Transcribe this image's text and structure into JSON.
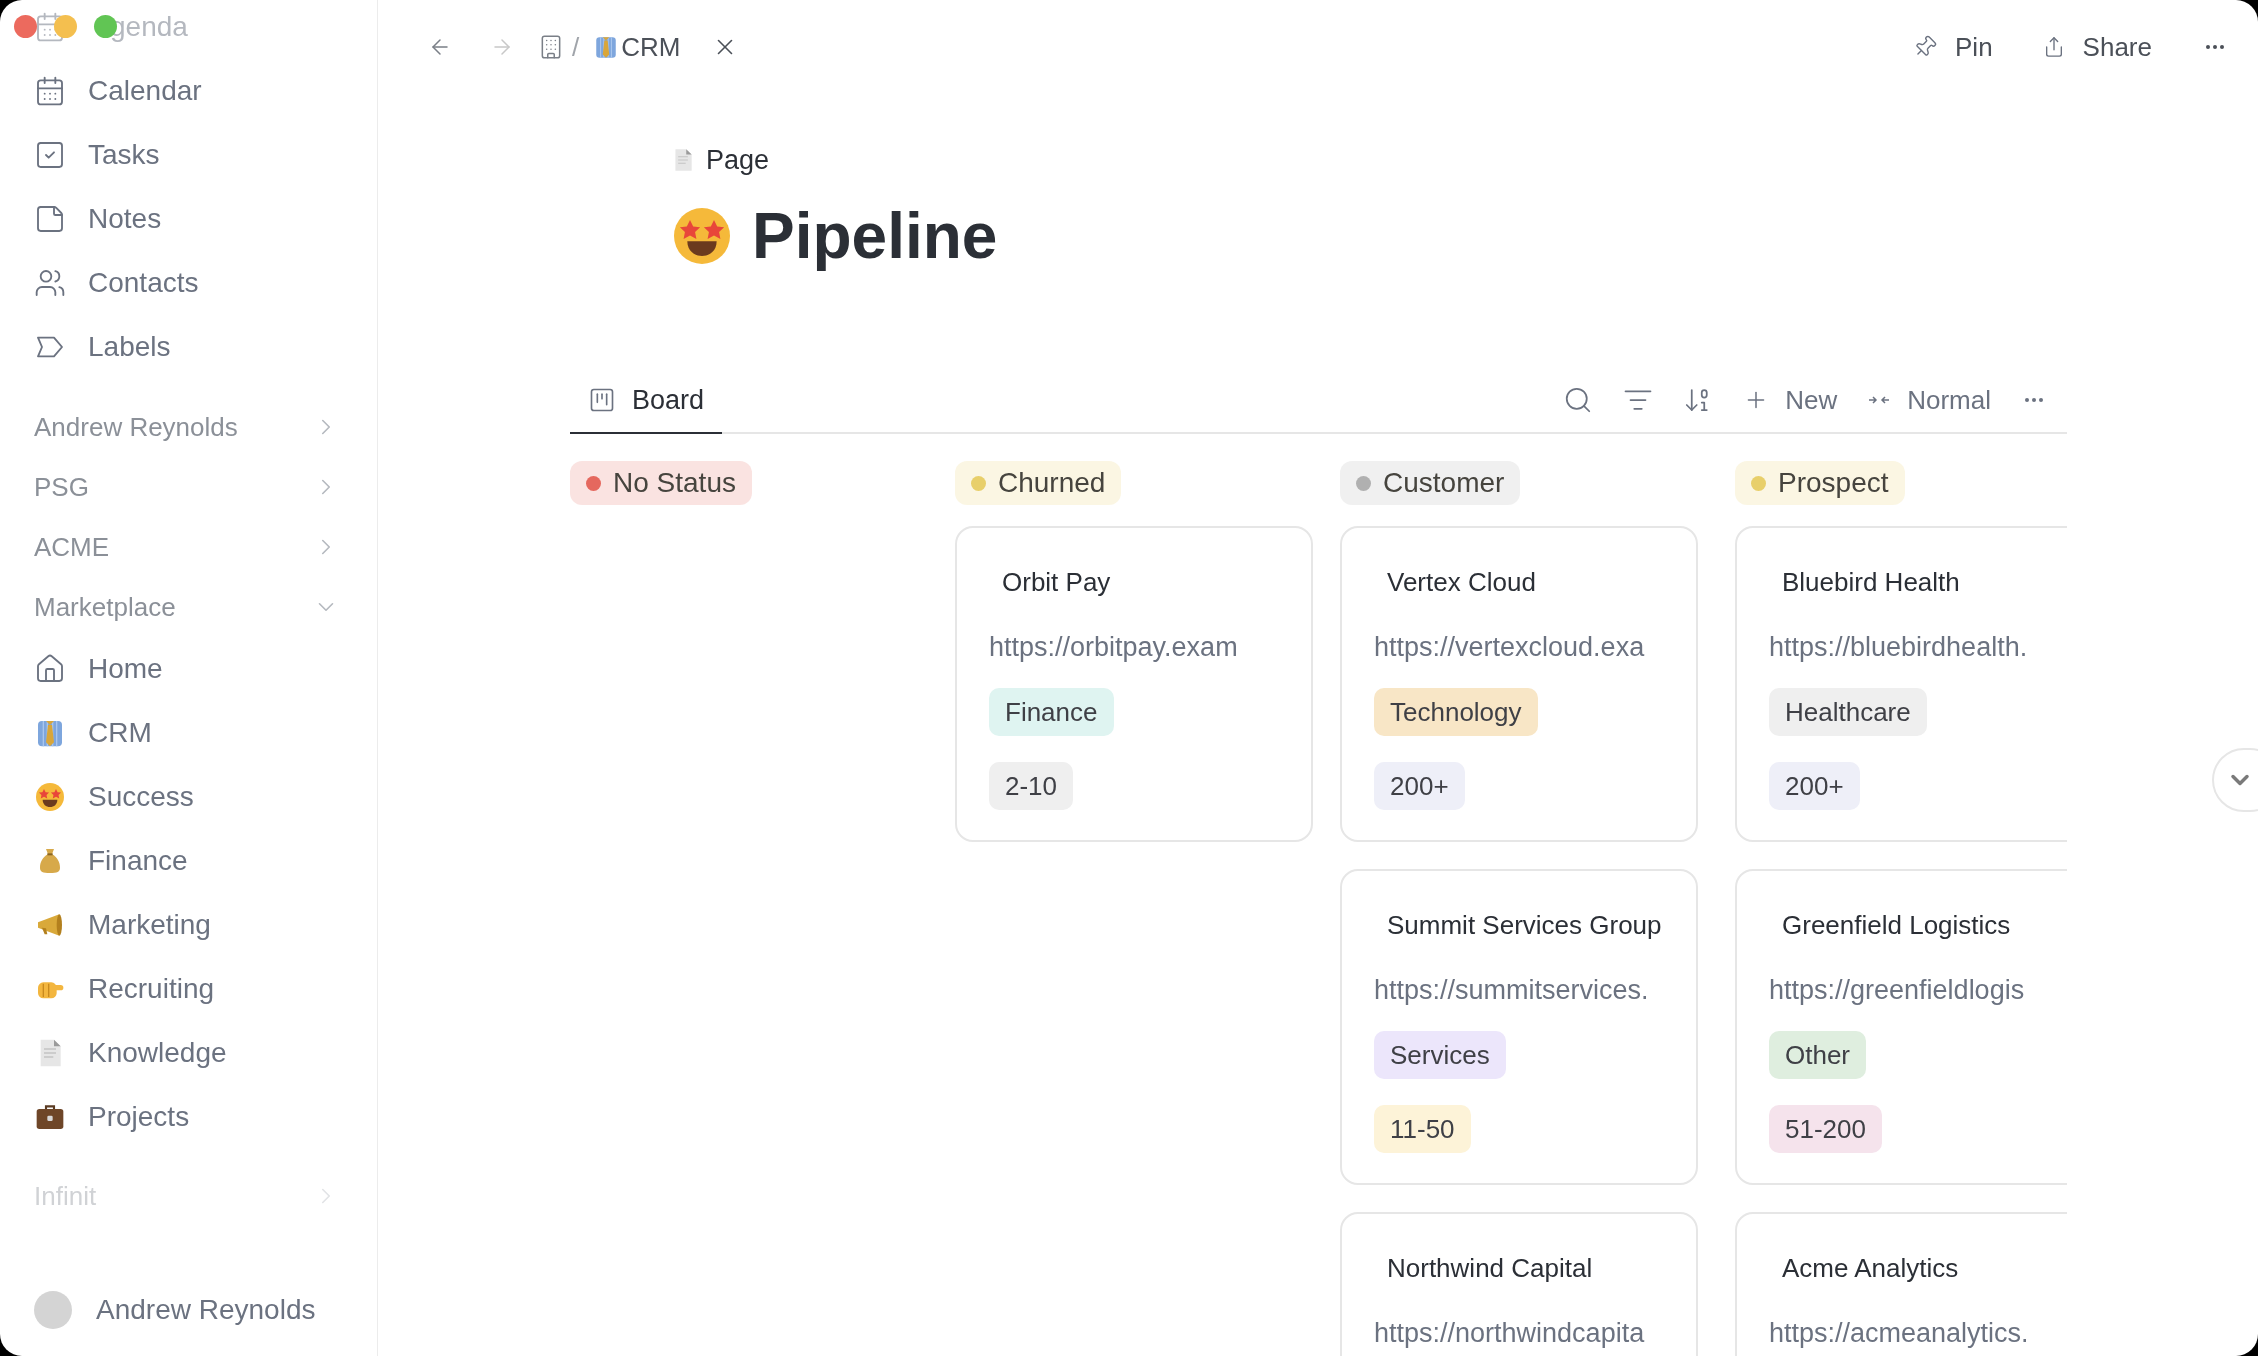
{
  "sidebar": {
    "items": [
      {
        "label": "genda",
        "faded": true
      },
      {
        "label": "Calendar",
        "faded": false
      },
      {
        "label": "Tasks",
        "faded": false
      },
      {
        "label": "Notes",
        "faded": false
      },
      {
        "label": "Contacts",
        "faded": false
      },
      {
        "label": "Labels",
        "faded": false
      }
    ],
    "sections": [
      {
        "label": "Andrew Reynolds",
        "expanded": false,
        "faded": false
      },
      {
        "label": "PSG",
        "expanded": false,
        "faded": false
      },
      {
        "label": "ACME",
        "expanded": false,
        "faded": false
      },
      {
        "label": "Marketplace",
        "expanded": true,
        "faded": false,
        "children": [
          {
            "label": "Home"
          },
          {
            "label": "CRM"
          },
          {
            "label": "Success"
          },
          {
            "label": "Finance"
          },
          {
            "label": "Marketing"
          },
          {
            "label": "Recruiting"
          },
          {
            "label": "Knowledge"
          },
          {
            "label": "Projects"
          }
        ]
      },
      {
        "label": "Infinit",
        "expanded": false,
        "faded": true
      }
    ],
    "user": {
      "name": "Andrew Reynolds"
    }
  },
  "topbar": {
    "back_disabled": false,
    "forward_disabled": true,
    "separator": "/",
    "current": "CRM",
    "actions": [
      "Pin",
      "Share"
    ]
  },
  "page": {
    "type_label": "Page",
    "title": "Pipeline"
  },
  "view": {
    "tabs": [
      {
        "label": "Board",
        "selected": true
      }
    ],
    "new_label": "New",
    "density_label": "Normal"
  },
  "board": {
    "columns": [
      {
        "label": "No Status",
        "color": "#e5685e"
      },
      {
        "label": "Churned",
        "color": "#e8cf6a",
        "cards": [
          {
            "name": "Orbit Pay",
            "url": "https://orbitpay.exam",
            "tags": [
              {
                "label": "Finance",
                "color": "#dff4f1"
              },
              {
                "label": "2-10",
                "color": "#efefef"
              }
            ]
          }
        ]
      },
      {
        "label": "Customer",
        "color": "#b0b0b0",
        "cards": [
          {
            "name": "Vertex Cloud",
            "url": "https://vertexcloud.exa",
            "tags": [
              {
                "label": "Technology",
                "color": "#f8e6c6"
              },
              {
                "label": "200+",
                "color": "#eeeff8"
              }
            ]
          },
          {
            "name": "Summit Services Group",
            "url": "https://summitservices.",
            "tags": [
              {
                "label": "Services",
                "color": "#ece6fb"
              },
              {
                "label": "11-50",
                "color": "#fdf3d8"
              }
            ]
          },
          {
            "name": "Northwind Capital",
            "url": "https://northwindcapita"
          }
        ]
      },
      {
        "label": "Prospect",
        "color": "#e8cf6a",
        "cards": [
          {
            "name": "Bluebird Health",
            "url": "https://bluebirdhealth.",
            "tags": [
              {
                "label": "Healthcare",
                "color": "#efefef"
              },
              {
                "label": "200+",
                "color": "#eeeff8"
              }
            ]
          },
          {
            "name": "Greenfield Logistics",
            "url": "https://greenfieldlogis",
            "tags": [
              {
                "label": "Other",
                "color": "#dfeedf"
              },
              {
                "label": "51-200",
                "color": "#f5e3ec"
              }
            ]
          },
          {
            "name": "Acme Analytics",
            "url": "https://acmeanalytics."
          }
        ]
      }
    ]
  }
}
